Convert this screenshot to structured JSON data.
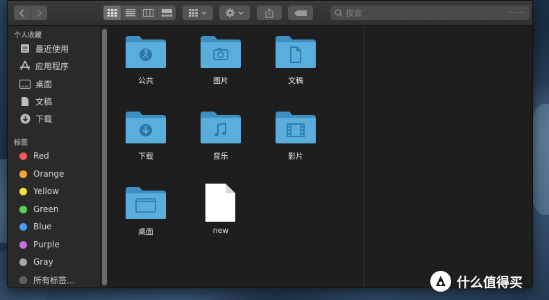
{
  "window": {
    "search": {
      "placeholder": "搜索"
    }
  },
  "sidebar": {
    "favorites_header": "个人收藏",
    "favorites": [
      {
        "label": "最近使用",
        "icon": "recents-icon"
      },
      {
        "label": "应用程序",
        "icon": "applications-icon"
      },
      {
        "label": "桌面",
        "icon": "desktop-icon"
      },
      {
        "label": "文稿",
        "icon": "documents-icon"
      },
      {
        "label": "下载",
        "icon": "downloads-icon"
      }
    ],
    "tags_header": "标签",
    "tags": [
      {
        "label": "Red",
        "color": "#f05a55"
      },
      {
        "label": "Orange",
        "color": "#f7a13b"
      },
      {
        "label": "Yellow",
        "color": "#f5e03a"
      },
      {
        "label": "Green",
        "color": "#5ad25a"
      },
      {
        "label": "Blue",
        "color": "#4a9af0"
      },
      {
        "label": "Purple",
        "color": "#c86ee0"
      },
      {
        "label": "Gray",
        "color": "#a6a6a6"
      },
      {
        "label": "所有标签...",
        "color": "#5a5a5a"
      }
    ]
  },
  "main": {
    "items": [
      {
        "label": "公共",
        "icon": "public-folder-icon"
      },
      {
        "label": "图片",
        "icon": "pictures-folder-icon"
      },
      {
        "label": "文稿",
        "icon": "documents-folder-icon"
      },
      {
        "label": "下载",
        "icon": "downloads-folder-icon"
      },
      {
        "label": "音乐",
        "icon": "music-folder-icon"
      },
      {
        "label": "影片",
        "icon": "movies-folder-icon"
      },
      {
        "label": "桌面",
        "icon": "desktop-folder-icon"
      },
      {
        "label": "new",
        "icon": "document-file-icon"
      }
    ]
  },
  "watermark": {
    "text": "什么值得买"
  },
  "colors": {
    "folder": "#5aaedc",
    "folder_dark": "#3f8fc2",
    "folder_glyph": "#2d76a6"
  }
}
